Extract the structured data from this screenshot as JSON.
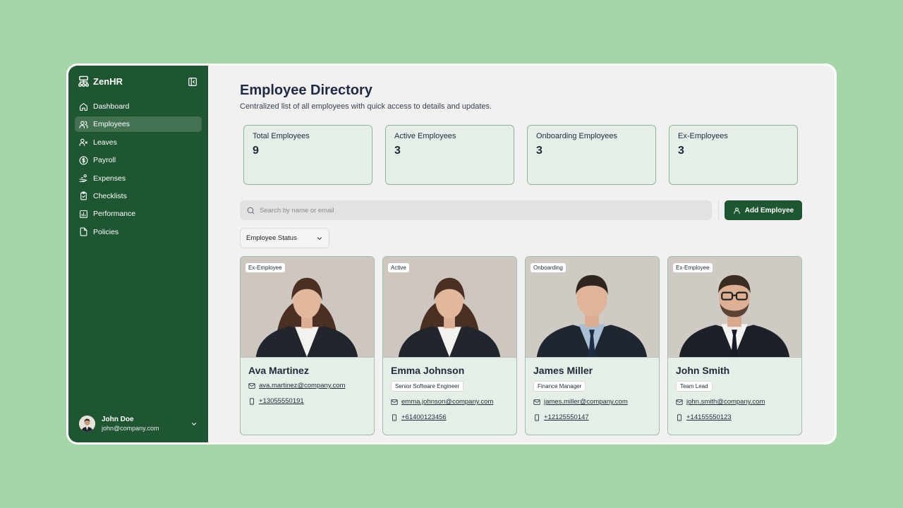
{
  "brand": {
    "name": "ZenHR"
  },
  "sidebar": {
    "items": [
      {
        "label": "Dashboard",
        "icon": "home-icon",
        "active": false
      },
      {
        "label": "Employees",
        "icon": "users-icon",
        "active": true
      },
      {
        "label": "Leaves",
        "icon": "user-x-icon",
        "active": false
      },
      {
        "label": "Payroll",
        "icon": "dollar-circle-icon",
        "active": false
      },
      {
        "label": "Expenses",
        "icon": "hand-coins-icon",
        "active": false
      },
      {
        "label": "Checklists",
        "icon": "clipboard-check-icon",
        "active": false
      },
      {
        "label": "Performance",
        "icon": "bar-chart-icon",
        "active": false
      },
      {
        "label": "Policies",
        "icon": "file-icon",
        "active": false
      }
    ],
    "user": {
      "name": "John Doe",
      "email": "john@company.com"
    }
  },
  "page": {
    "title": "Employee Directory",
    "subtitle": "Centralized list of all employees with quick access to details and updates."
  },
  "stats": [
    {
      "label": "Total Employees",
      "value": "9"
    },
    {
      "label": "Active Employees",
      "value": "3"
    },
    {
      "label": "Onboarding Employees",
      "value": "3"
    },
    {
      "label": "Ex-Employees",
      "value": "3"
    }
  ],
  "search": {
    "placeholder": "Search by name or email",
    "value": ""
  },
  "add_button": {
    "label": "Add Employee"
  },
  "filter": {
    "label": "Employee Status"
  },
  "employees": [
    {
      "status": "Ex-Employee",
      "name": "Ava Martinez",
      "role": "",
      "email": "ava.martinez@company.com",
      "phone": "+13055550191",
      "gender": "female"
    },
    {
      "status": "Active",
      "name": "Emma Johnson",
      "role": "Senior Software Engineer",
      "email": "emma.johnson@company.com",
      "phone": "+61400123456",
      "gender": "female"
    },
    {
      "status": "Onboarding",
      "name": "James Miller",
      "role": "Finance Manager",
      "email": "james.miller@company.com",
      "phone": "+12125550147",
      "gender": "male"
    },
    {
      "status": "Ex-Employee",
      "name": "John Smith",
      "role": "Team Lead",
      "email": "john.smith@company.com",
      "phone": "+14155550123",
      "gender": "male-glasses"
    }
  ],
  "colors": {
    "sidebar": "#1e5631",
    "accent": "#1e5631",
    "card_bg": "#e5efe8",
    "page_bg": "#a5d6a7"
  }
}
